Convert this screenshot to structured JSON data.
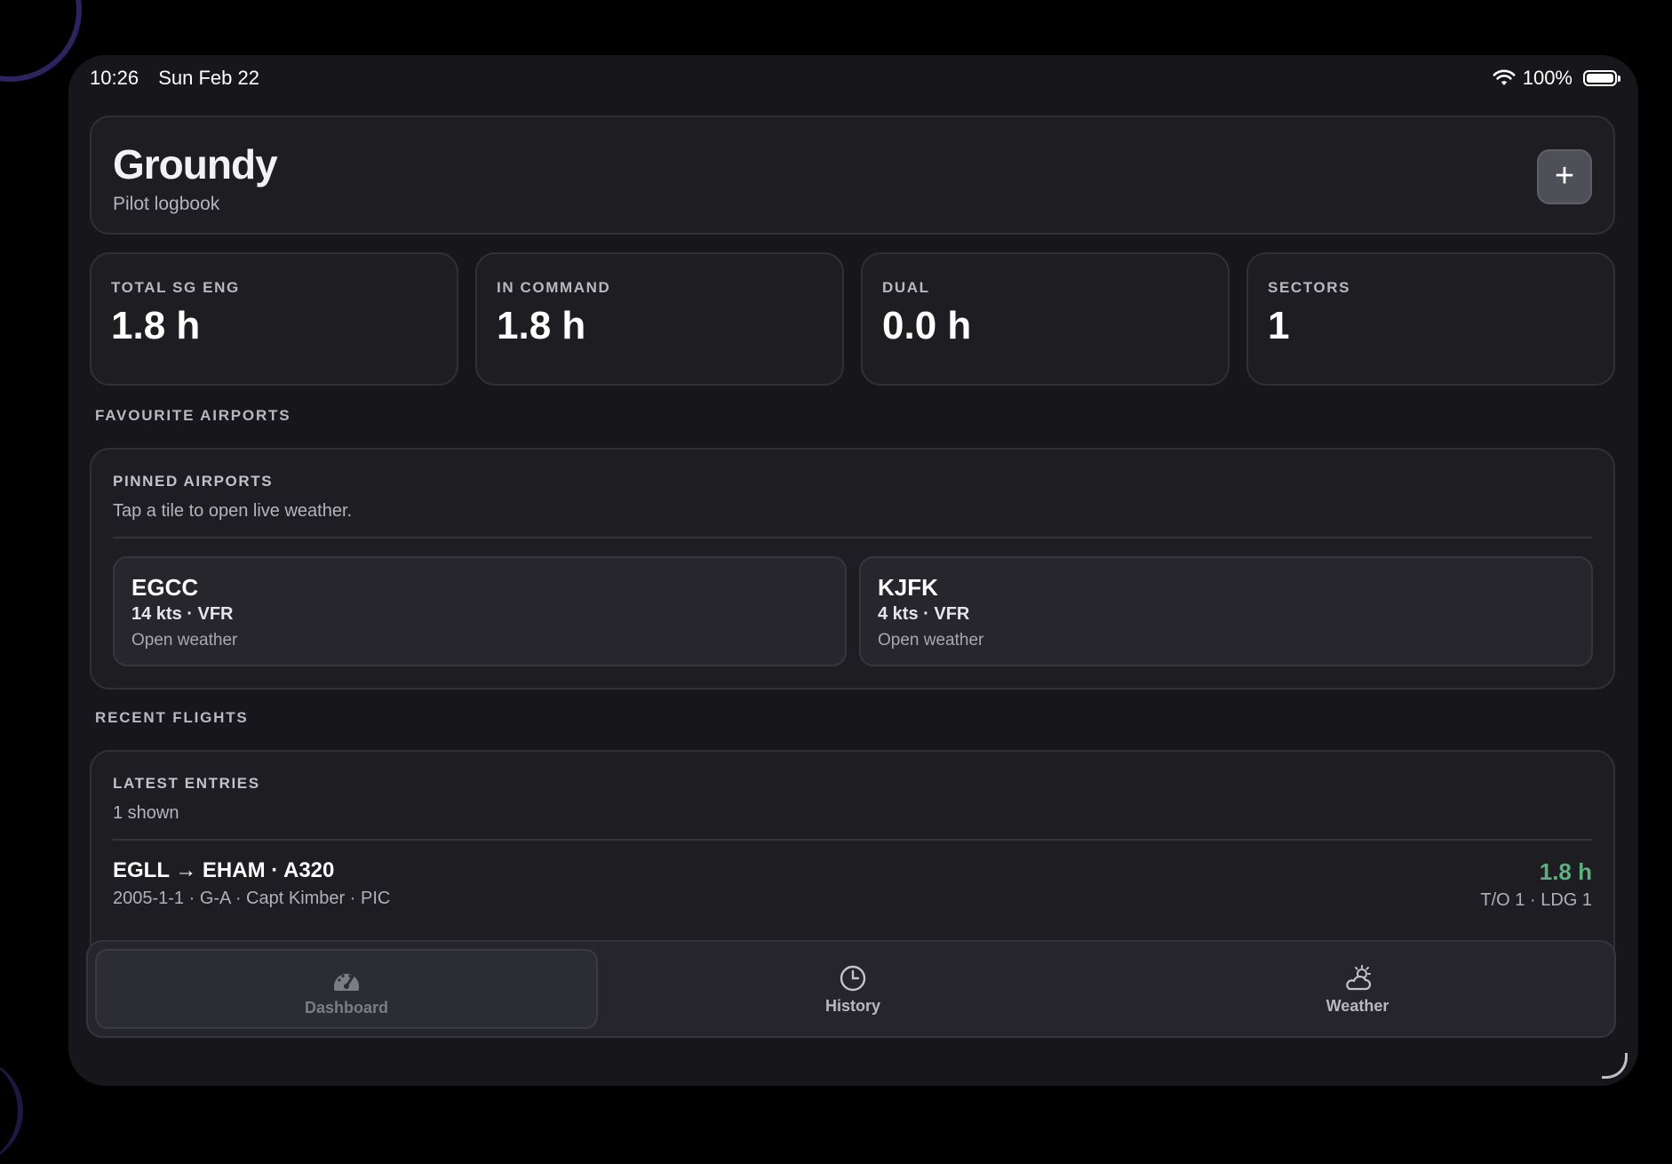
{
  "status_bar": {
    "time": "10:26",
    "date": "Sun Feb 22",
    "battery": "100%"
  },
  "header": {
    "title": "Groundy",
    "subtitle": "Pilot logbook",
    "add_button": "+"
  },
  "stats": [
    {
      "label": "TOTAL SG ENG",
      "value": "1.8 h"
    },
    {
      "label": "IN COMMAND",
      "value": "1.8 h"
    },
    {
      "label": "DUAL",
      "value": "0.0 h"
    },
    {
      "label": "SECTORS",
      "value": "1"
    }
  ],
  "favourites": {
    "section_title": "FAVOURITE AIRPORTS",
    "card_title": "PINNED AIRPORTS",
    "card_subtitle": "Tap a tile to open live weather.",
    "airports": [
      {
        "code": "EGCC",
        "meta": "14 kts · VFR",
        "action": "Open weather"
      },
      {
        "code": "KJFK",
        "meta": "4 kts · VFR",
        "action": "Open weather"
      }
    ]
  },
  "recent": {
    "section_title": "RECENT FLIGHTS",
    "card_title": "LATEST ENTRIES",
    "card_subtitle": "1 shown",
    "flights": [
      {
        "route": "EGLL → EHAM · A320",
        "details": "2005-1-1 · G-A · Capt Kimber · PIC",
        "time": "1.8 h",
        "counts": "T/O 1 · LDG 1"
      }
    ]
  },
  "tabs": [
    {
      "label": "Dashboard",
      "icon": "gauge-icon",
      "active": true
    },
    {
      "label": "History",
      "icon": "clock-icon",
      "active": false
    },
    {
      "label": "Weather",
      "icon": "partly-cloudy-icon",
      "active": false
    }
  ],
  "colors": {
    "background": "#17171b",
    "card": "#1d1d22",
    "accent_green": "#5fae7f",
    "add_button": "#4f4f57"
  }
}
